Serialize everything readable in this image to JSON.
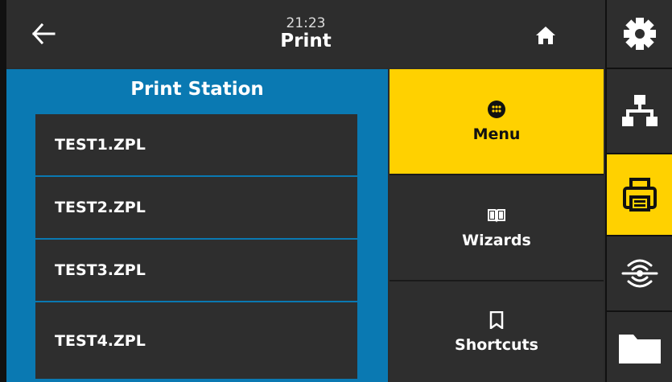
{
  "header": {
    "time": "21:23",
    "title": "Print"
  },
  "station": {
    "title": "Print Station",
    "files": [
      "TEST1.ZPL",
      "TEST2.ZPL",
      "TEST3.ZPL",
      "TEST4.ZPL"
    ]
  },
  "menu": [
    {
      "label": "Menu",
      "icon": "grid-dots-icon",
      "active": true
    },
    {
      "label": "Wizards",
      "icon": "book-icon",
      "active": false
    },
    {
      "label": "Shortcuts",
      "icon": "bookmark-icon",
      "active": false
    }
  ],
  "rail": [
    {
      "icon": "settings-gear-icon",
      "active": false
    },
    {
      "icon": "network-icon",
      "active": false
    },
    {
      "icon": "printer-icon",
      "active": true
    },
    {
      "icon": "rfid-icon",
      "active": false
    },
    {
      "icon": "folder-icon",
      "active": false
    }
  ],
  "colors": {
    "accent": "#ffd100",
    "panel": "#0a79b2",
    "button": "#2e2e2e"
  }
}
